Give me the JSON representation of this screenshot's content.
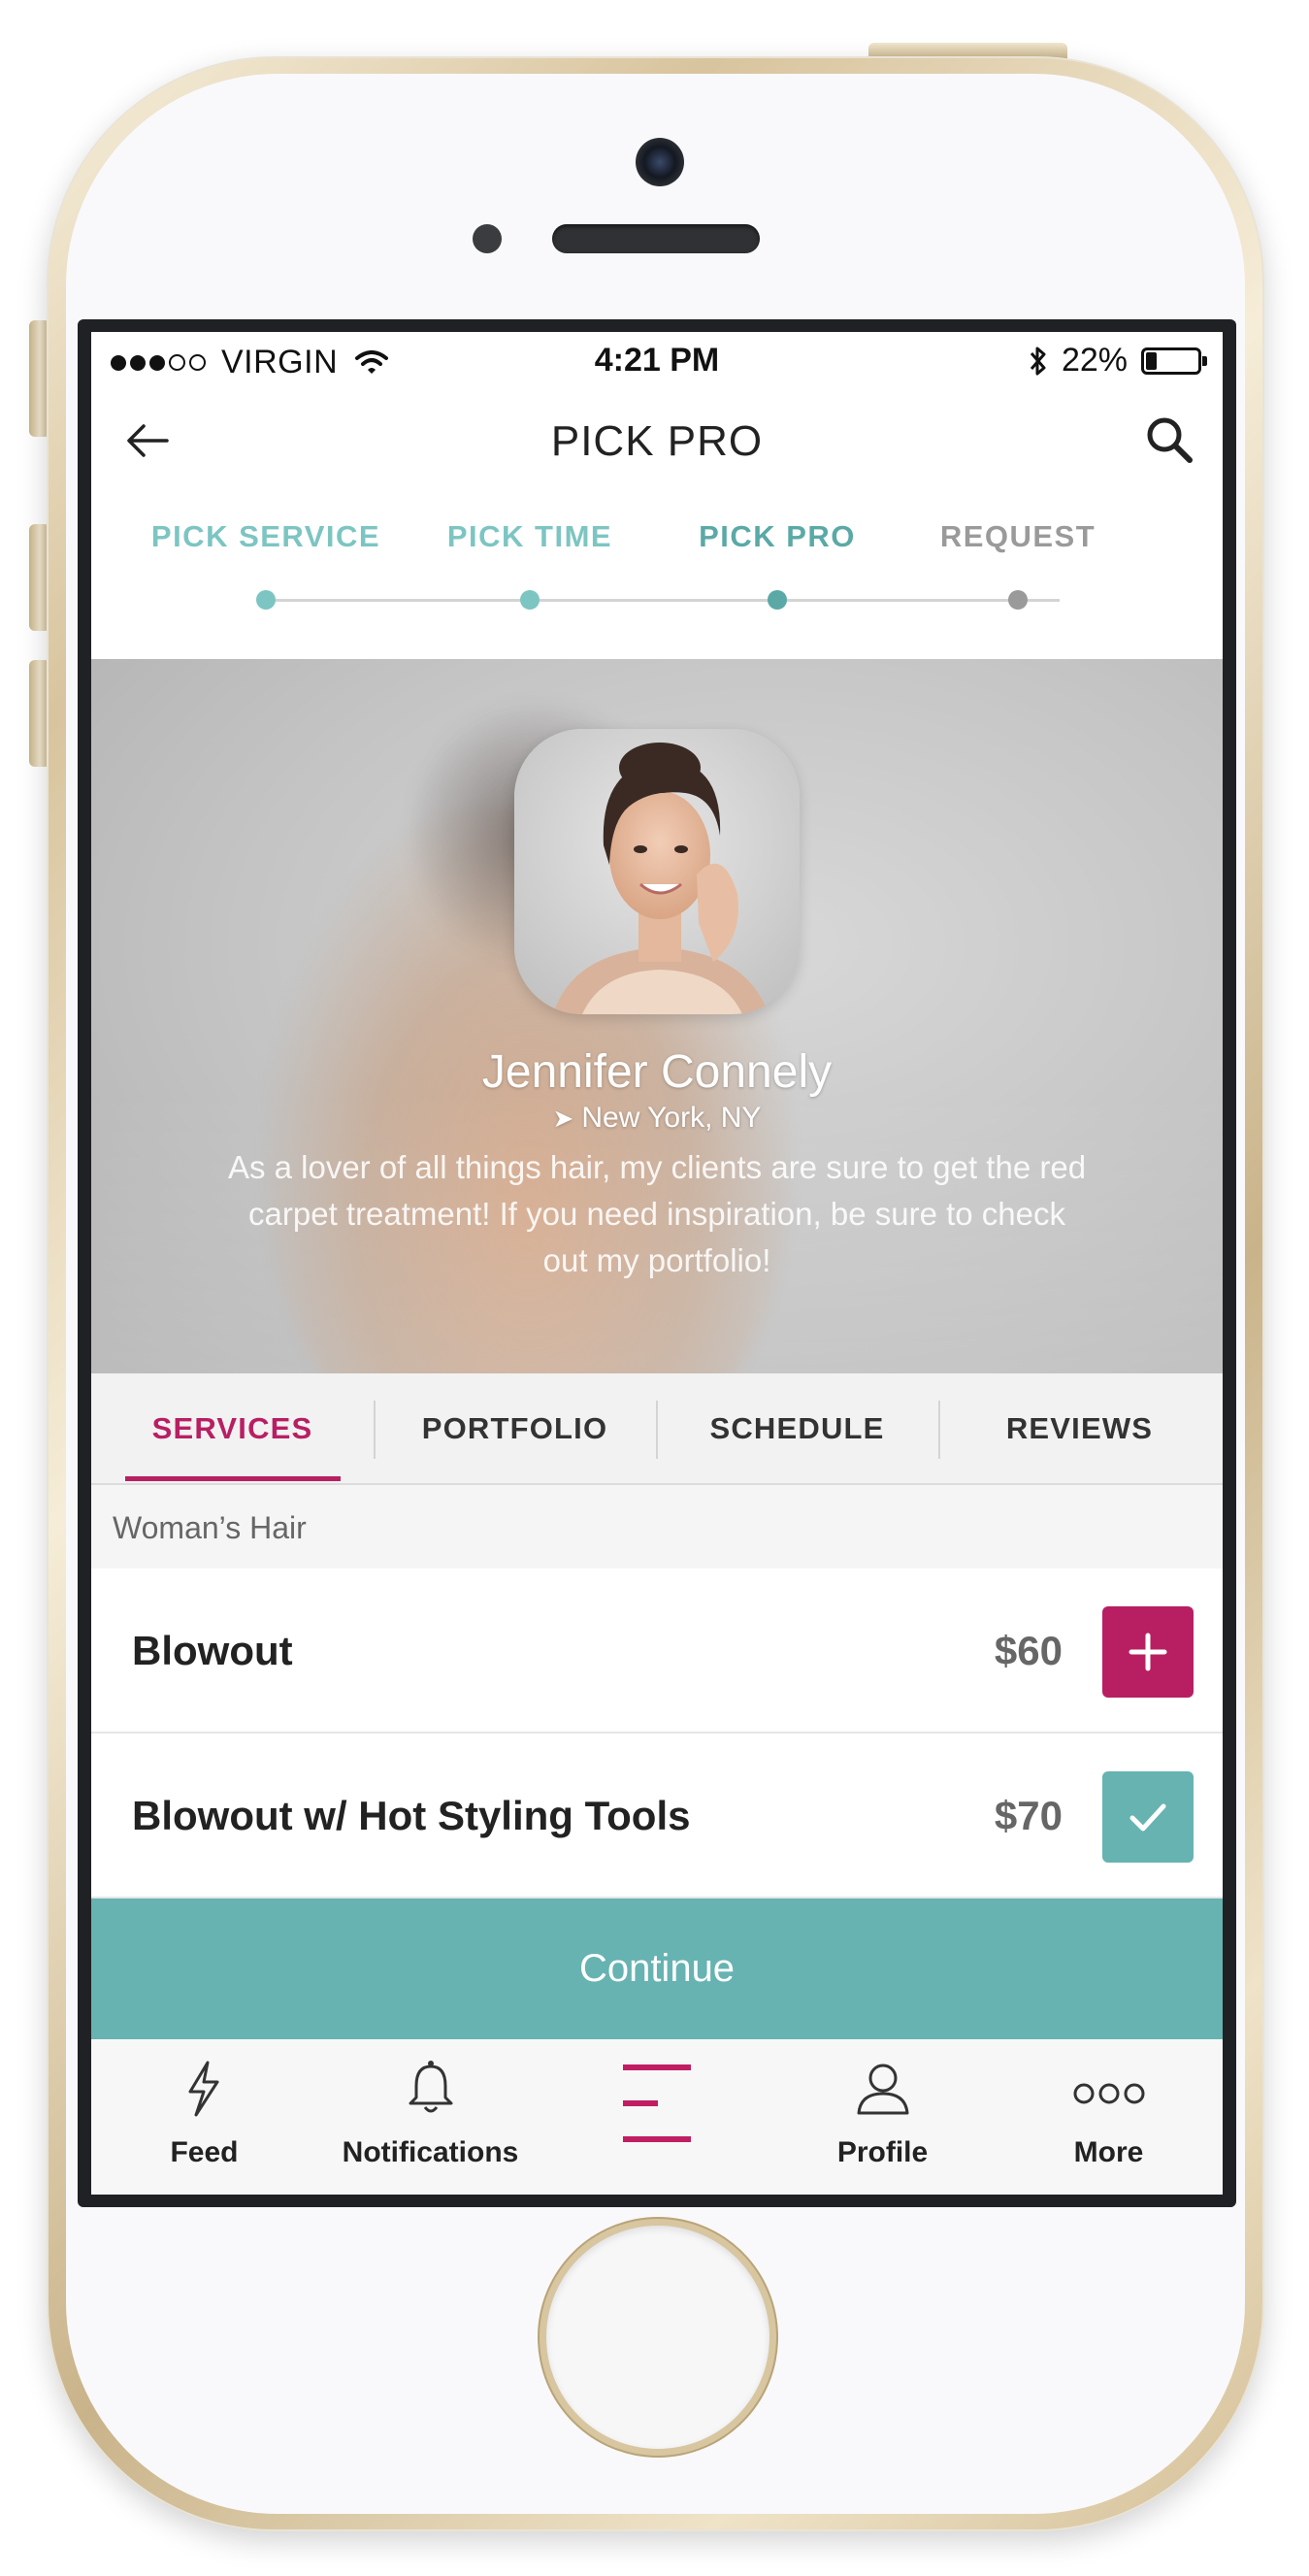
{
  "status_bar": {
    "carrier": "VIRGIN",
    "time": "4:21 PM",
    "battery": "22%",
    "battery_level": 0.22
  },
  "nav": {
    "title": "PICK PRO"
  },
  "stepper": {
    "steps": [
      {
        "label": "PICK SERVICE",
        "color": "#7cc5c2"
      },
      {
        "label": "PICK TIME",
        "color": "#7cc5c2"
      },
      {
        "label": "PICK PRO",
        "color": "#5aa9a7"
      },
      {
        "label": "REQUEST",
        "color": "#9a9a9a"
      }
    ]
  },
  "profile": {
    "name": "Jennifer Connely",
    "location": "New York, NY",
    "bio": "As a lover of all things hair, my clients are sure to get the red carpet treatment! If you need inspiration, be sure to check out my portfolio!"
  },
  "tabs": {
    "items": [
      {
        "label": "SERVICES",
        "active": true
      },
      {
        "label": "PORTFOLIO",
        "active": false
      },
      {
        "label": "SCHEDULE",
        "active": false
      },
      {
        "label": "REVIEWS",
        "active": false
      }
    ]
  },
  "services": {
    "category": "Woman’s Hair",
    "items": [
      {
        "name": "Blowout",
        "price": "$60",
        "state": "add"
      },
      {
        "name": "Blowout w/ Hot Styling Tools",
        "price": "$70",
        "state": "selected"
      }
    ]
  },
  "continue_label": "Continue",
  "tabbar": {
    "items": [
      {
        "label": "Feed",
        "icon": "lightning-icon"
      },
      {
        "label": "Notifications",
        "icon": "bell-icon"
      },
      {
        "label": "",
        "icon": "menu-icon"
      },
      {
        "label": "Profile",
        "icon": "person-icon"
      },
      {
        "label": "More",
        "icon": "more-dots-icon"
      }
    ]
  },
  "colors": {
    "accent_magenta": "#b81f63",
    "accent_teal": "#66b3b2"
  }
}
